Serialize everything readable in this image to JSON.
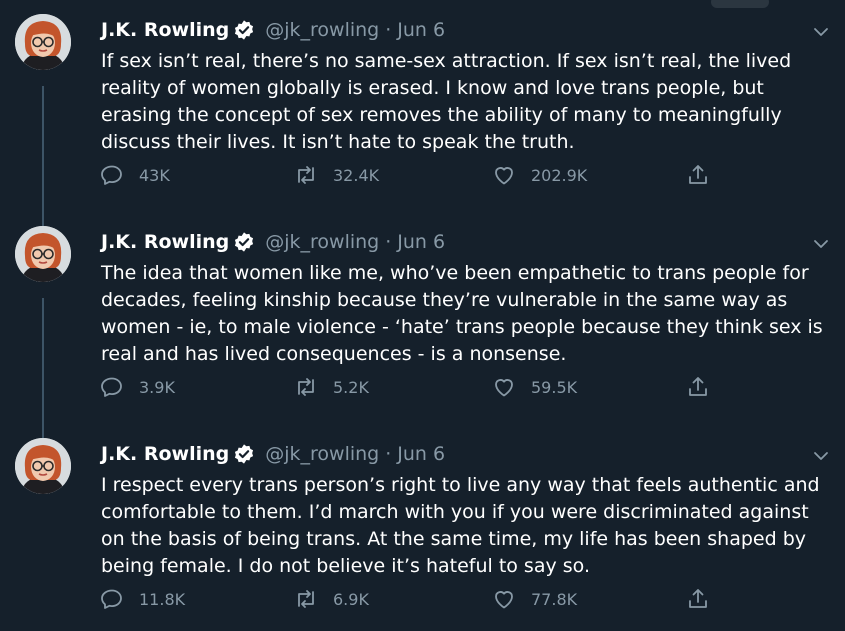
{
  "tweets": [
    {
      "author": "J.K. Rowling",
      "handle": "@jk_rowling",
      "separator": "·",
      "date": "Jun 6",
      "text": "If sex isn’t real, there’s no same-sex attraction. If sex isn’t real, the lived reality of women globally is erased. I know and love trans people, but erasing the concept of sex removes the ability of many to meaningfully discuss their lives. It isn’t hate to speak the truth.",
      "replies": "43K",
      "retweets": "32.4K",
      "likes": "202.9K"
    },
    {
      "author": "J.K. Rowling",
      "handle": "@jk_rowling",
      "separator": "·",
      "date": "Jun 6",
      "text": "The idea that women like me, who’ve been empathetic to trans people for decades, feeling kinship because they’re vulnerable in the same way as women - ie, to male violence - ‘hate’ trans people because they think sex is real and has lived consequences - is a nonsense.",
      "replies": "3.9K",
      "retweets": "5.2K",
      "likes": "59.5K"
    },
    {
      "author": "J.K. Rowling",
      "handle": "@jk_rowling",
      "separator": "·",
      "date": "Jun 6",
      "text": "I respect every trans person’s right to live any way that feels authentic and comfortable to them. I’d march with you if you were discriminated against on the basis of being trans. At the same time, my life has been shaped by being female. I do not believe it’s hateful to say so.",
      "replies": "11.8K",
      "retweets": "6.9K",
      "likes": "77.8K"
    }
  ],
  "theme": {
    "background": "#15202b",
    "text": "#ffffff",
    "muted": "#8899a6",
    "verified": "#ffffff",
    "thread_line": "#3d5466"
  },
  "icons": {
    "reply": "reply-icon",
    "retweet": "retweet-icon",
    "like": "like-icon",
    "share": "share-icon",
    "verified": "verified-icon",
    "more": "chevron-down-icon"
  }
}
